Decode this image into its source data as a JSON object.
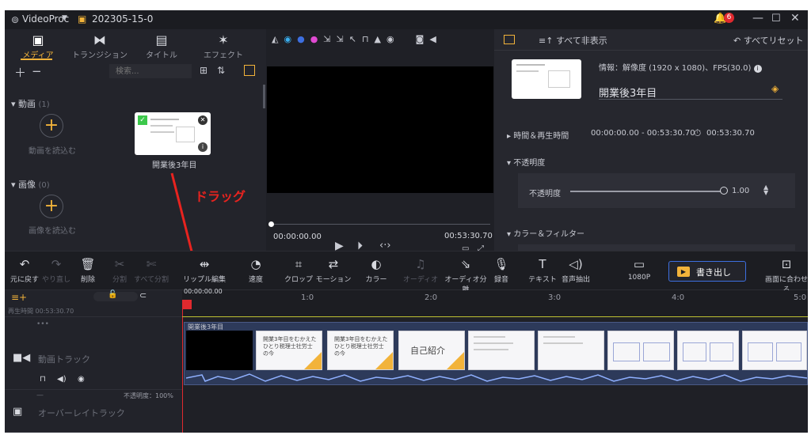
{
  "titlebar": {
    "app_name": "VideoProc",
    "project_name": "202305-15-0",
    "notification_count": "6"
  },
  "media_tabs": [
    {
      "label": "メディア",
      "icon": "media-icon",
      "active": true
    },
    {
      "label": "トランジション",
      "icon": "transition-icon",
      "active": false
    },
    {
      "label": "タイトル",
      "icon": "title-icon",
      "active": false
    },
    {
      "label": "エフェクト",
      "icon": "effect-icon",
      "active": false
    }
  ],
  "media_library": {
    "search_placeholder": "検索...",
    "video_section": "動画",
    "video_count": "(1)",
    "video_add_label": "動画を読込む",
    "image_section": "画像",
    "image_count": "(0)",
    "image_add_label": "画像を読込む",
    "clip_name": "開業後3年目"
  },
  "annotation": {
    "drag_label": "ドラッグ",
    "color": "#e8231f"
  },
  "preview": {
    "current_time": "00:00:00.00",
    "total_time": "00:53:30.70"
  },
  "inspector": {
    "hide_all": "すべて非表示",
    "reset_all": "すべてリセット",
    "info": "情報：解像度 (1920 x 1080)、FPS(30.0)",
    "clip_title": "開業後3年目",
    "time_section": "時間＆再生時間",
    "time_range": "00:00:00.00 - 00:53:30.70",
    "duration": "00:53:30.70",
    "opacity_section": "不透明度",
    "opacity_label": "不透明度",
    "opacity_value": "1.00",
    "color_section": "カラー＆フィルター"
  },
  "toolbar": {
    "undo": "元に戻す",
    "redo": "やり直し",
    "delete": "削除",
    "split": "分割",
    "split_all": "すべて分割",
    "ripple_edit": "リップル編集",
    "speed": "速度",
    "crop": "クロップ",
    "motion": "モーション",
    "color": "カラー",
    "audio": "オーディオ",
    "audio_split": "オーディオ分離",
    "record": "録音",
    "text": "テキスト",
    "extract_audio": "音声抽出",
    "resolution": "1080P",
    "export": "書き出し",
    "fit": "画面に合わせる"
  },
  "timeline": {
    "playhead_time": "00:00:00.00",
    "duration_label": "再生時間",
    "duration_value": "00:53:30.70",
    "ruler_labels": [
      "1:0",
      "2:0",
      "3:0",
      "4:0",
      "5:0"
    ],
    "video_track": "動画トラック",
    "overlay_track": "オーバーレイトラック",
    "overlay_opacity": "不透明度：100%",
    "clip_label": "開業後3年目",
    "slide_title": "開業3年目をむかえた\nひとり税理士社労士\nの今",
    "slide_intro": "自己紹介"
  },
  "colors": {
    "accent": "#f2b33a",
    "export_border": "#3d6fe0",
    "playhead": "#e0292e",
    "track_clip": "#2d3a5a"
  }
}
